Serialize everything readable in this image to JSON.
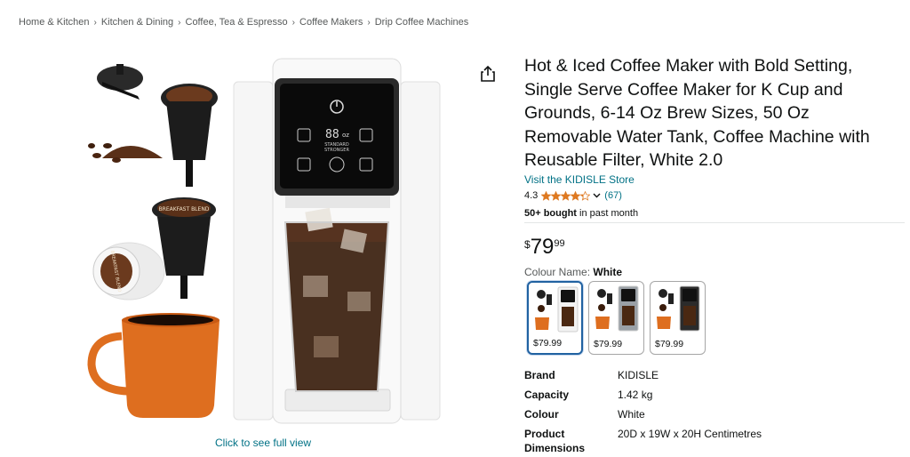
{
  "breadcrumb": [
    "Home & Kitchen",
    "Kitchen & Dining",
    "Coffee, Tea & Espresso",
    "Coffee Makers",
    "Drip Coffee Machines"
  ],
  "breadcrumb_separator": "›",
  "gallery": {
    "caption": "Click to see full view",
    "display": {
      "digits": "88",
      "unit": "oz",
      "mode_top": "STANDARD",
      "mode_bottom": "STRONGER"
    },
    "pod_label": "BREAKFAST BLEND"
  },
  "product": {
    "title": "Hot & Iced Coffee Maker with Bold Setting, Single Serve Coffee Maker for K Cup and Grounds, 6-14 Oz Brew Sizes, 50 Oz Removable Water Tank, Coffee Machine with Reusable Filter, White 2.0",
    "store_link": "Visit the KIDISLE Store",
    "rating": "4.3",
    "rating_value": 4.3,
    "rating_count": "(67)",
    "bought_bold": "50+ bought",
    "bought_rest": " in past month",
    "price": {
      "symbol": "$",
      "whole": "79",
      "fraction": "99"
    },
    "colour_label": "Colour Name: ",
    "colour_value": "White",
    "swatches": [
      {
        "price": "$79.99",
        "selected": true,
        "body_color": "#f2f2f2"
      },
      {
        "price": "$79.99",
        "selected": false,
        "body_color": "#9aa0a6"
      },
      {
        "price": "$79.99",
        "selected": false,
        "body_color": "#2b2b2b"
      }
    ],
    "specs": [
      {
        "key": "Brand",
        "value": "KIDISLE"
      },
      {
        "key": "Capacity",
        "value": "1.42 kg"
      },
      {
        "key": "Colour",
        "value": "White"
      },
      {
        "key": "Product Dimensions",
        "value": "20D x 19W x 20H Centimetres"
      }
    ]
  },
  "colors": {
    "link": "#007185",
    "star": "#de7921",
    "selected_border": "#2162a1",
    "muted_text": "#565959"
  }
}
